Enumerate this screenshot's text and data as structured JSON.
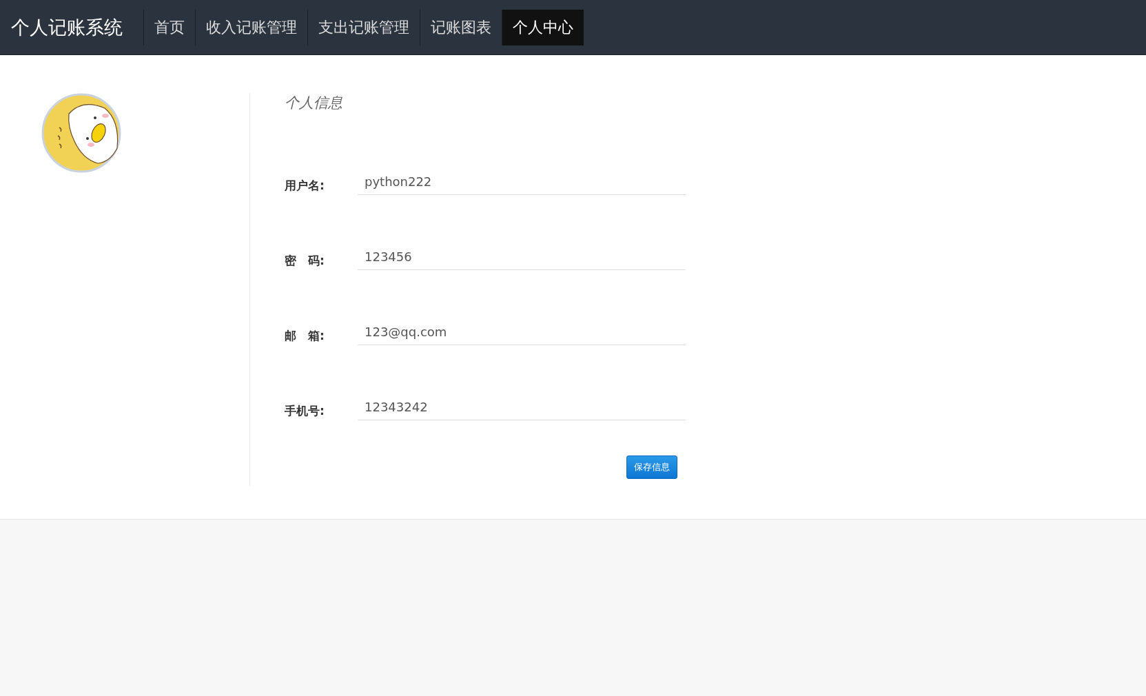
{
  "navbar": {
    "brand": "个人记账系统",
    "items": [
      {
        "label": "首页",
        "selected": false
      },
      {
        "label": "收入记账管理",
        "selected": false
      },
      {
        "label": "支出记账管理",
        "selected": false
      },
      {
        "label": "记账图表",
        "selected": false
      },
      {
        "label": "个人中心",
        "selected": true
      }
    ]
  },
  "profile": {
    "heading": "个人信息",
    "fields": [
      {
        "label": "用户名:",
        "value": "python222"
      },
      {
        "label": "密　码:",
        "value": "123456"
      },
      {
        "label": "邮　箱:",
        "value": "123@qq.com"
      },
      {
        "label": "手机号:",
        "value": "12343242"
      }
    ],
    "save_button": "保存信息"
  }
}
